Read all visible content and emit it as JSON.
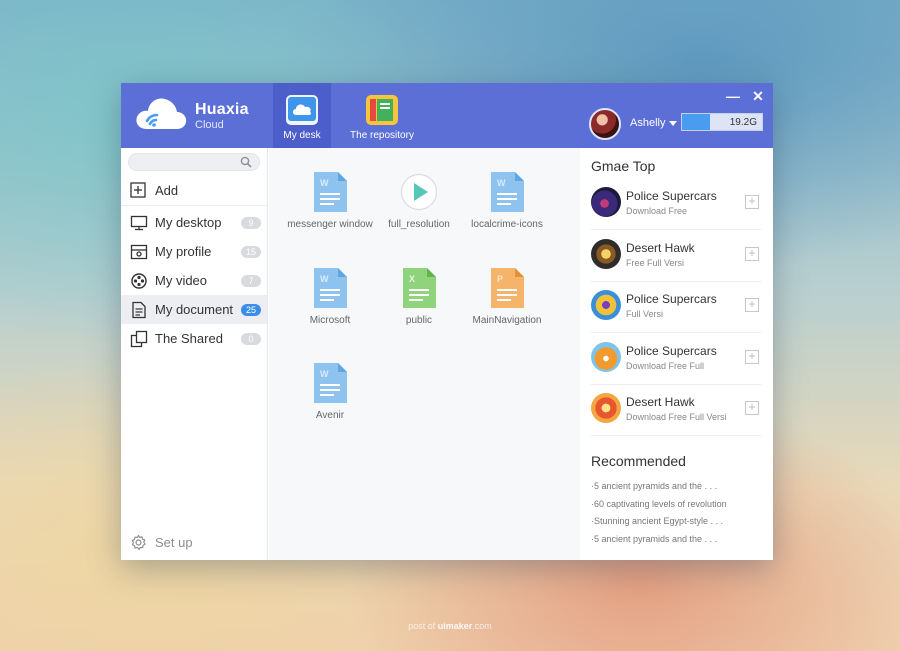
{
  "app": {
    "brand_name": "Huaxia",
    "brand_sub": "Cloud"
  },
  "nav": {
    "tabs": [
      {
        "label": "My desk",
        "icon": "cloud-icon",
        "active": true
      },
      {
        "label": "The repository",
        "icon": "books-icon",
        "active": false
      }
    ]
  },
  "user": {
    "name": "Ashelly",
    "storage_label": "19.2G",
    "storage_fraction": 0.35
  },
  "window_controls": {
    "minimize": "—",
    "close": "✕"
  },
  "sidebar": {
    "search_placeholder": "",
    "add_label": "Add",
    "items": [
      {
        "label": "My desktop",
        "count": "9",
        "icon": "monitor-icon"
      },
      {
        "label": "My profile",
        "count": "15",
        "icon": "profile-icon"
      },
      {
        "label": "My video",
        "count": "7",
        "icon": "film-reel-icon"
      },
      {
        "label": "My document",
        "count": "25",
        "icon": "document-icon"
      },
      {
        "label": "The Shared",
        "count": "0",
        "icon": "shared-icon"
      }
    ],
    "setup_label": "Set up"
  },
  "files": [
    {
      "name": "messenger window",
      "type": "word"
    },
    {
      "name": "full_resolution",
      "type": "video"
    },
    {
      "name": "localcrime-icons",
      "type": "word"
    },
    {
      "name": "Microsoft",
      "type": "word"
    },
    {
      "name": "public",
      "type": "excel"
    },
    {
      "name": "MainNavigation",
      "type": "ppt"
    },
    {
      "name": "Avenir",
      "type": "word"
    }
  ],
  "games": {
    "title": "Gmae Top",
    "items": [
      {
        "name": "Police Supercars",
        "sub": "Download Free"
      },
      {
        "name": "Desert Hawk",
        "sub": "Free Full Versi"
      },
      {
        "name": "Police Supercars",
        "sub": "Full Versi"
      },
      {
        "name": "Police Supercars",
        "sub": "Download Free Full"
      },
      {
        "name": "Desert Hawk",
        "sub": "Download Free Full Versi"
      }
    ],
    "add_symbol": "+"
  },
  "recommended": {
    "title": "Recommended",
    "items": [
      "·5 ancient pyramids and the . . .",
      "·60 captivating levels of revolution",
      "·Stunning ancient Egypt-style . . .",
      "·5 ancient pyramids and the . . ."
    ]
  },
  "credit": {
    "prefix": "post of ",
    "brand": "uimaker",
    "suffix": ".com"
  },
  "colors": {
    "header": "#5b6fd6",
    "header_active": "#4c5ec9",
    "accent_blue": "#3b8ee8"
  }
}
